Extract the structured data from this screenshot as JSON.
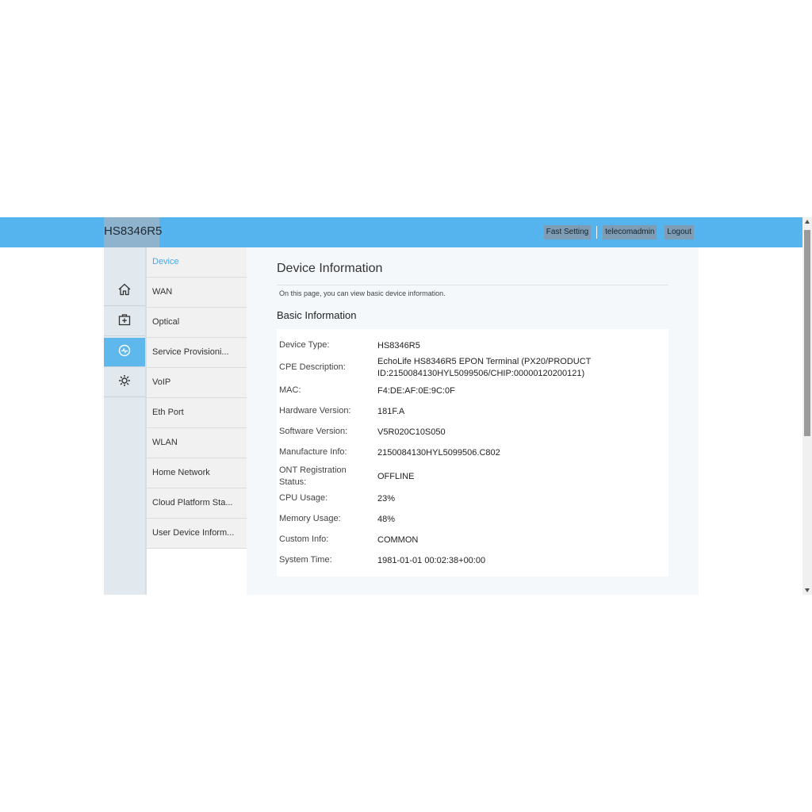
{
  "header": {
    "brand": "HS8346R5",
    "fast_setting": "Fast Setting",
    "user": "telecomadmin",
    "logout": "Logout"
  },
  "rail": {
    "items": [
      {
        "icon": "home-icon"
      },
      {
        "icon": "briefcase-plus-icon"
      },
      {
        "icon": "status-circle-icon",
        "active": true
      },
      {
        "icon": "gear-icon"
      }
    ]
  },
  "submenu": {
    "items": [
      {
        "label": "Device",
        "active": true
      },
      {
        "label": "WAN"
      },
      {
        "label": "Optical"
      },
      {
        "label": "Service Provisioni..."
      },
      {
        "label": "VoIP"
      },
      {
        "label": "Eth Port"
      },
      {
        "label": "WLAN"
      },
      {
        "label": "Home Network"
      },
      {
        "label": "Cloud Platform Sta..."
      },
      {
        "label": "User Device Inform..."
      }
    ]
  },
  "main": {
    "title": "Device Information",
    "description": "On this page, you can view basic device information.",
    "section": "Basic Information",
    "rows": [
      {
        "key": "Device Type:",
        "value": "HS8346R5"
      },
      {
        "key": "CPE Description:",
        "value": "EchoLife HS8346R5 EPON Terminal (PX20/PRODUCT ID:2150084130HYL5099506/CHIP:00000120200121)"
      },
      {
        "key": "MAC:",
        "value": "F4:DE:AF:0E:9C:0F"
      },
      {
        "key": "Hardware Version:",
        "value": "181F.A"
      },
      {
        "key": "Software Version:",
        "value": "V5R020C10S050"
      },
      {
        "key": "Manufacture Info:",
        "value": "2150084130HYL5099506.C802"
      },
      {
        "key": "ONT Registration Status:",
        "value": "OFFLINE"
      },
      {
        "key": "CPU Usage:",
        "value": "23%"
      },
      {
        "key": "Memory Usage:",
        "value": "48%"
      },
      {
        "key": "Custom Info:",
        "value": "COMMON"
      },
      {
        "key": "System Time:",
        "value": "1981-01-01 00:02:38+00:00"
      }
    ]
  },
  "colors": {
    "header_bg": "#55b4ee",
    "accent": "#4aa6e3",
    "active_rail": "#5fb8ec"
  }
}
